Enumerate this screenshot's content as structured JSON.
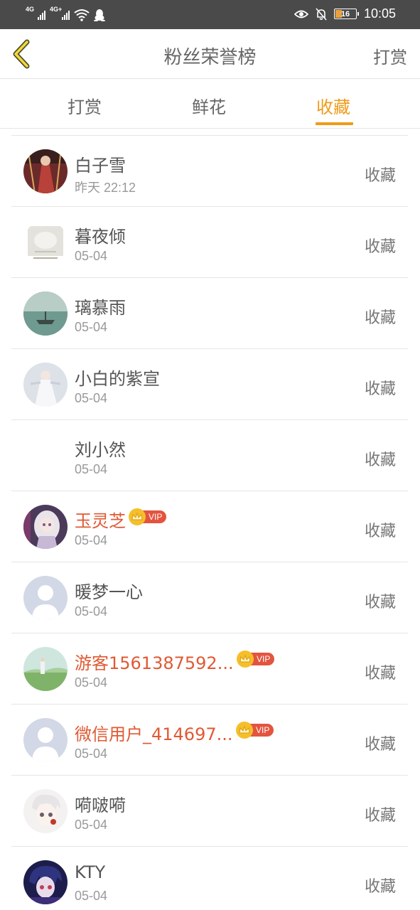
{
  "status_bar": {
    "sim1_label": "4G",
    "sim2_label": "4G+",
    "battery_level": "16",
    "time": "10:05"
  },
  "header": {
    "title": "粉丝荣誉榜",
    "action_label": "打赏"
  },
  "tabs": {
    "items": [
      {
        "label": "打赏"
      },
      {
        "label": "鲜花"
      },
      {
        "label": "收藏"
      }
    ],
    "active": "收藏",
    "accent_color": "#ef9b1a"
  },
  "list": {
    "action_label": "收藏",
    "vip_label": "VIP",
    "vip_name_color": "#e05a33",
    "rows": [
      {
        "name": "白子雪",
        "date": "昨天 22:12",
        "vip": false,
        "avatar": "red-costume"
      },
      {
        "name": "暮夜倾",
        "date": "05-04",
        "vip": false,
        "avatar": "white-scene"
      },
      {
        "name": "璃慕雨",
        "date": "05-04",
        "vip": false,
        "avatar": "lake-boat"
      },
      {
        "name": "小白的紫宣",
        "date": "05-04",
        "vip": false,
        "avatar": "white-dress"
      },
      {
        "name": "刘小然",
        "date": "05-04",
        "vip": false,
        "avatar": "none"
      },
      {
        "name": "玉灵芝",
        "date": "05-04",
        "vip": true,
        "avatar": "anime-girl"
      },
      {
        "name": "暖梦一心",
        "date": "05-04",
        "vip": false,
        "avatar": "default-user"
      },
      {
        "name": "游客1561387592...",
        "date": "05-04",
        "vip": true,
        "avatar": "landscape"
      },
      {
        "name": "微信用户_414697...",
        "date": "05-04",
        "vip": true,
        "avatar": "default-user"
      },
      {
        "name": "嗬啵嗬",
        "date": "05-04",
        "vip": false,
        "avatar": "anime-boy"
      },
      {
        "name": "KTY",
        "date": "05-04",
        "vip": false,
        "avatar": "anime-dark"
      }
    ]
  }
}
